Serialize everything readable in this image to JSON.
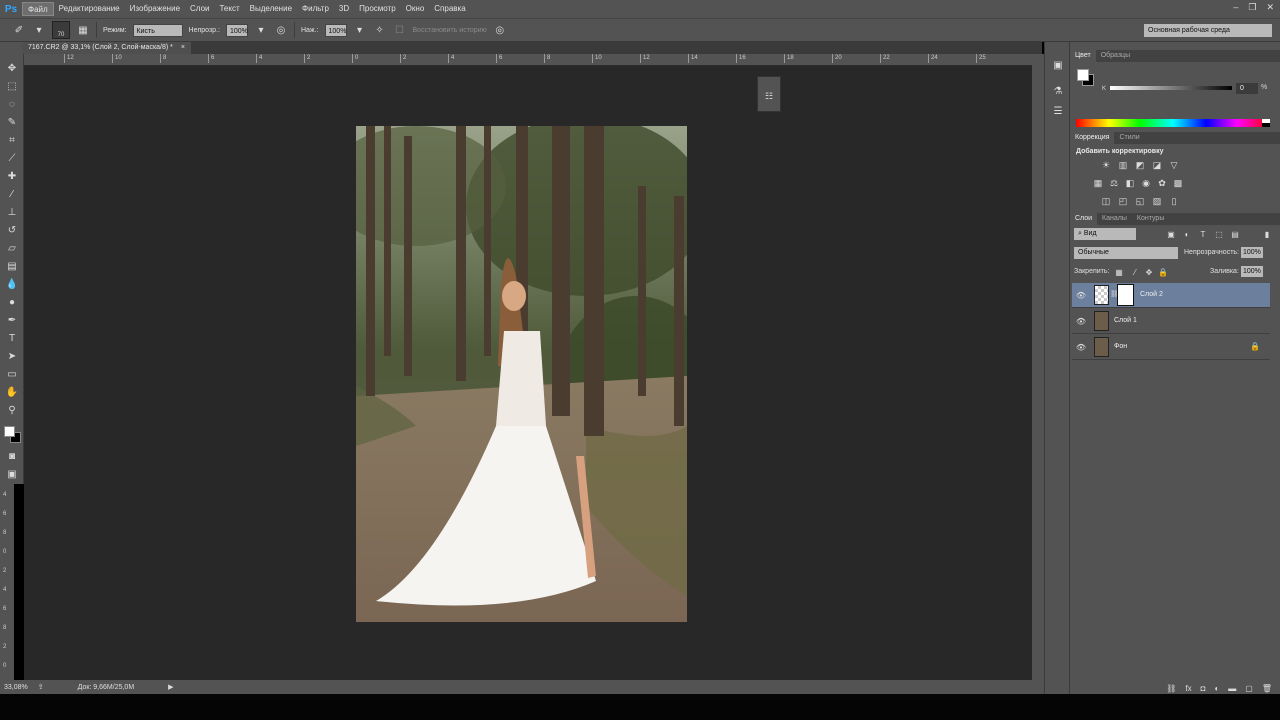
{
  "menubar": {
    "logo": "Ps",
    "items": [
      "Файл",
      "Редактирование",
      "Изображение",
      "Слои",
      "Текст",
      "Выделение",
      "Фильтр",
      "3D",
      "Просмотр",
      "Окно",
      "Справка"
    ],
    "window_controls": [
      "–",
      "❐",
      "✕"
    ]
  },
  "options": {
    "brush_size": "70",
    "mode_label": "Режим:",
    "mode_value": "Кисть",
    "opacity_label": "Непрозр.:",
    "opacity_value": "100%",
    "flow_label": "Наж.:",
    "flow_value": "100%",
    "history_label": "Восстановить историю",
    "workspace": "Основная рабочая среда"
  },
  "document": {
    "tab_title": "7167.CR2 @ 33,1% (Слой 2, Слой-маска/8) *",
    "tab_close": "×"
  },
  "ruler": {
    "top_ticks": [
      "12",
      "10",
      "8",
      "6",
      "4",
      "2",
      "0",
      "2",
      "4",
      "6",
      "8",
      "10",
      "12",
      "14",
      "16",
      "18",
      "20",
      "22",
      "24",
      "25"
    ],
    "left_ticks": [
      "4",
      "6",
      "8",
      "0",
      "2",
      "4",
      "6",
      "8",
      "2",
      "0"
    ]
  },
  "status": {
    "zoom": "33,08%",
    "doc_info": "Док: 9,66M/25,0M",
    "arrow": "▶"
  },
  "color_panel": {
    "tabs": [
      "Цвет",
      "Образцы"
    ],
    "channel_label": "K",
    "channel_value": "0",
    "unit": "%"
  },
  "adjustments_panel": {
    "tabs": [
      "Коррекция",
      "Стили"
    ],
    "heading": "Добавить корректировку"
  },
  "layers_panel": {
    "tabs": [
      "Слои",
      "Каналы",
      "Контуры"
    ],
    "filter_label": "Вид",
    "blend_mode": "Обычные",
    "opacity_label": "Непрозрачность:",
    "opacity_value": "100%",
    "lock_label": "Закрепить:",
    "fill_label": "Заливка:",
    "fill_value": "100%",
    "layers": [
      {
        "name": "Слой 2",
        "selected": true,
        "has_mask": true,
        "locked": false
      },
      {
        "name": "Слой 1",
        "selected": false,
        "has_mask": false,
        "locked": false
      },
      {
        "name": "Фон",
        "selected": false,
        "has_mask": false,
        "locked": true
      }
    ],
    "footer_icons": [
      "link-icon",
      "fx-icon",
      "mask-icon",
      "adjustment-icon",
      "folder-icon",
      "new-layer-icon",
      "trash-icon"
    ]
  },
  "colors": {
    "ui_bg": "#535353",
    "canvas_bg": "#282828",
    "selected_layer": "#6c7f9c",
    "ps_blue": "#31a8ff"
  }
}
